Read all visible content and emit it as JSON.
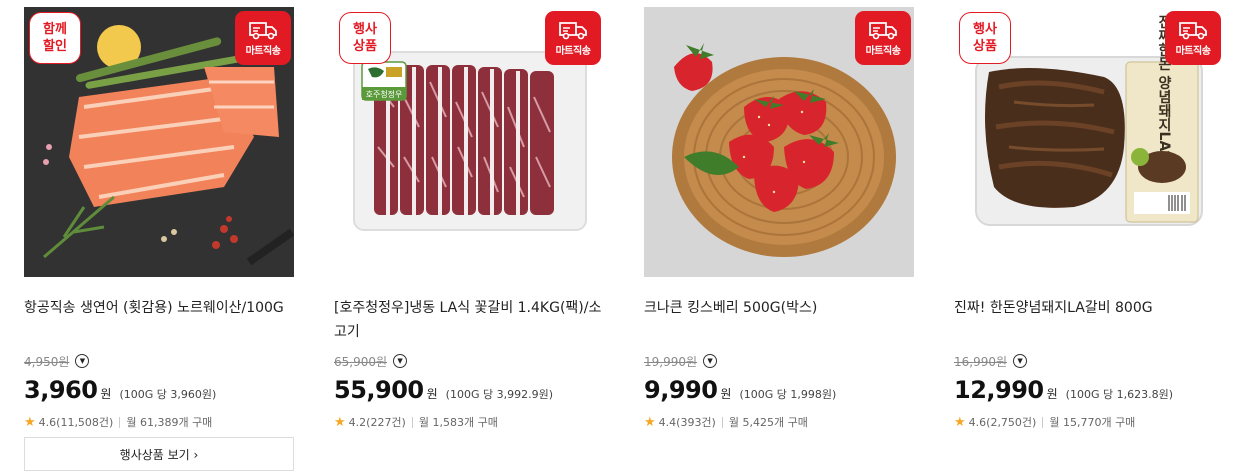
{
  "products": [
    {
      "badge_left": [
        "함께",
        "할인"
      ],
      "badge_right": "마트직송",
      "title": "항공직송 생연어 (횟감용) 노르웨이산/100G",
      "original_price": "4,950",
      "won": "원",
      "price": "3,960",
      "unit_price": "(100G 당 3,960원)",
      "rating": "4.6(11,508건)",
      "monthly": "월 61,389개 구매"
    },
    {
      "badge_left": [
        "행사",
        "상품"
      ],
      "badge_right": "마트직송",
      "title": "[호주청정우]냉동 LA식 꽃갈비 1.4KG(팩)/소고기",
      "original_price": "65,900",
      "won": "원",
      "price": "55,900",
      "unit_price": "(100G 당 3,992.9원)",
      "rating": "4.2(227건)",
      "monthly": "월 1,583개 구매",
      "image_label": "호주청정우"
    },
    {
      "badge_left": null,
      "badge_right": "마트직송",
      "title": "크나큰 킹스베리 500G(박스)",
      "original_price": "19,990",
      "won": "원",
      "price": "9,990",
      "unit_price": "(100G 당 1,998원)",
      "rating": "4.4(393건)",
      "monthly": "월 5,425개 구매"
    },
    {
      "badge_left": [
        "행사",
        "상품"
      ],
      "badge_right": "마트직송",
      "title": "진짜! 한돈양념돼지LA갈비 800G",
      "original_price": "16,990",
      "won": "원",
      "price": "12,990",
      "unit_price": "(100G 당 1,623.8원)",
      "rating": "4.6(2,750건)",
      "monthly": "월 15,770개 구매",
      "image_label": "진짜한돈 양념돼지LA갈비"
    }
  ],
  "view_button": "행사상품 보기 ›",
  "colors": {
    "accent": "#e21a24",
    "star": "#f5a623"
  }
}
